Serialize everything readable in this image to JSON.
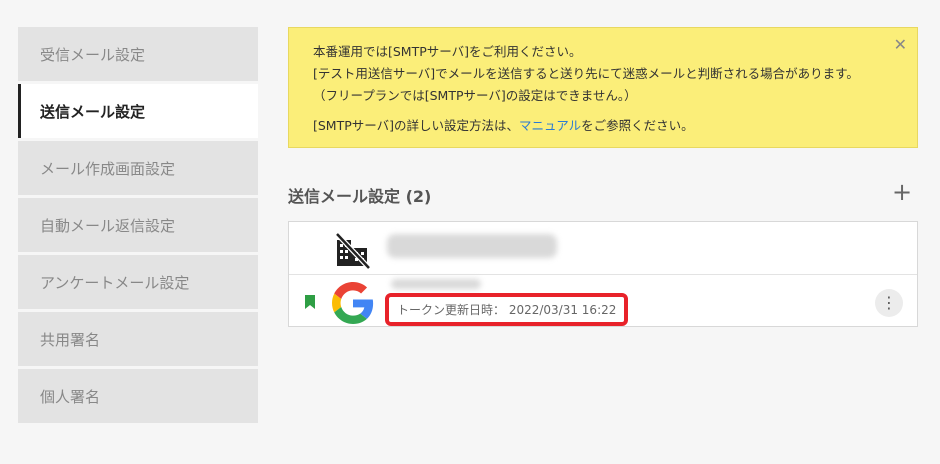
{
  "sidebar": {
    "items": [
      {
        "label": "受信メール設定",
        "active": false
      },
      {
        "label": "送信メール設定",
        "active": true
      },
      {
        "label": "メール作成画面設定",
        "active": false
      },
      {
        "label": "自動メール返信設定",
        "active": false
      },
      {
        "label": "アンケートメール設定",
        "active": false
      },
      {
        "label": "共用署名",
        "active": false
      },
      {
        "label": "個人署名",
        "active": false
      }
    ]
  },
  "notice": {
    "line1": "本番運用では[SMTPサーバ]をご利用ください。",
    "line2": "[テスト用送信サーバ]でメールを送信すると送り先にて迷惑メールと判断される場合があります。",
    "line3": "（フリープランでは[SMTPサーバ]の設定はできません。）",
    "line4_prefix": "[SMTPサーバ]の詳しい設定方法は、",
    "line4_link": "マニュアル",
    "line4_suffix": "をご参照ください。",
    "close_icon": "close-icon"
  },
  "section": {
    "title": "送信メール設定 (2)",
    "add_icon": "plus-icon"
  },
  "accounts": [
    {
      "icon": "domain-disabled-icon"
    },
    {
      "icon": "google-icon",
      "token_label": "トークン更新日時： 2022/03/31 16:22",
      "bookmark_color": "#2e9e44"
    }
  ],
  "colors": {
    "notice_bg": "#fbee79",
    "highlight": "#e8222a",
    "link": "#2a7bd4"
  }
}
